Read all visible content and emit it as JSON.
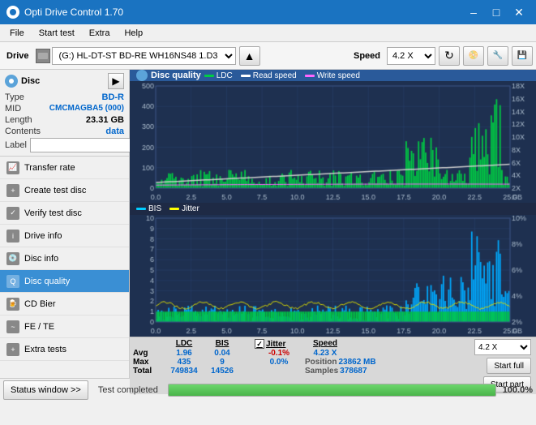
{
  "titleBar": {
    "title": "Opti Drive Control 1.70",
    "minimize": "–",
    "maximize": "□",
    "close": "✕"
  },
  "menuBar": {
    "items": [
      "File",
      "Start test",
      "Extra",
      "Help"
    ]
  },
  "toolbar": {
    "driveLabel": "Drive",
    "driveValue": "(G:)  HL-DT-ST BD-RE  WH16NS48 1.D3",
    "speedLabel": "Speed",
    "speedValue": "4.2 X"
  },
  "disc": {
    "header": "Disc",
    "typeLabel": "Type",
    "typeValue": "BD-R",
    "midLabel": "MID",
    "midValue": "CMCMAGBA5 (000)",
    "lengthLabel": "Length",
    "lengthValue": "23.31 GB",
    "contentsLabel": "Contents",
    "contentsValue": "data",
    "labelLabel": "Label"
  },
  "nav": {
    "items": [
      {
        "id": "transfer-rate",
        "label": "Transfer rate"
      },
      {
        "id": "create-test-disc",
        "label": "Create test disc"
      },
      {
        "id": "verify-test-disc",
        "label": "Verify test disc"
      },
      {
        "id": "drive-info",
        "label": "Drive info"
      },
      {
        "id": "disc-info",
        "label": "Disc info"
      },
      {
        "id": "disc-quality",
        "label": "Disc quality",
        "active": true
      },
      {
        "id": "cd-bier",
        "label": "CD Bier"
      },
      {
        "id": "fe-te",
        "label": "FE / TE"
      },
      {
        "id": "extra-tests",
        "label": "Extra tests"
      }
    ]
  },
  "discQuality": {
    "header": "Disc quality",
    "legend": {
      "ldc": "LDC",
      "readSpeed": "Read speed",
      "writeSpeed": "Write speed",
      "bis": "BIS",
      "jitter": "Jitter"
    },
    "chart1": {
      "yMax": 500,
      "xMax": 25,
      "yRight": [
        "18X",
        "16X",
        "14X",
        "12X",
        "10X",
        "8X",
        "6X",
        "4X",
        "2X"
      ],
      "xLabels": [
        "0.0",
        "2.5",
        "5.0",
        "7.5",
        "10.0",
        "12.5",
        "15.0",
        "17.5",
        "20.0",
        "22.5",
        "25.0"
      ],
      "yLabels": [
        "500",
        "400",
        "300",
        "200",
        "100"
      ]
    },
    "chart2": {
      "yMax": 10,
      "xMax": 25,
      "yRightPct": [
        "10%",
        "8%",
        "6%",
        "4%",
        "2%"
      ],
      "xLabels": [
        "0.0",
        "2.5",
        "5.0",
        "7.5",
        "10.0",
        "12.5",
        "15.0",
        "17.5",
        "20.0",
        "22.5",
        "25.0"
      ],
      "yLabels": [
        "10",
        "9",
        "8",
        "7",
        "6",
        "5",
        "4",
        "3",
        "2",
        "1"
      ]
    },
    "stats": {
      "columns": [
        "",
        "LDC",
        "BIS",
        "",
        "Jitter",
        "Speed",
        ""
      ],
      "avgLabel": "Avg",
      "avgLDC": "1.96",
      "avgBIS": "0.04",
      "avgJitter": "-0.1%",
      "maxLabel": "Max",
      "maxLDC": "435",
      "maxBIS": "9",
      "maxJitter": "0.0%",
      "totalLabel": "Total",
      "totalLDC": "749834",
      "totalBIS": "14526",
      "speedVal": "4.23 X",
      "speedDropdown": "4.2 X",
      "positionLabel": "Position",
      "positionVal": "23862 MB",
      "samplesLabel": "Samples",
      "samplesVal": "378687",
      "startFull": "Start full",
      "startPart": "Start part"
    }
  },
  "statusBar": {
    "btnLabel": "Status window >>",
    "statusText": "Test completed",
    "progress": 100,
    "progressText": "100.0%"
  },
  "colors": {
    "ldc": "#00cc44",
    "readSpeed": "#ffffff",
    "writeSpeed": "#ff66ff",
    "bis": "#00ccff",
    "jitter": "#ffff00",
    "gridBg": "#1e3050",
    "gridLine": "#2a4070"
  }
}
